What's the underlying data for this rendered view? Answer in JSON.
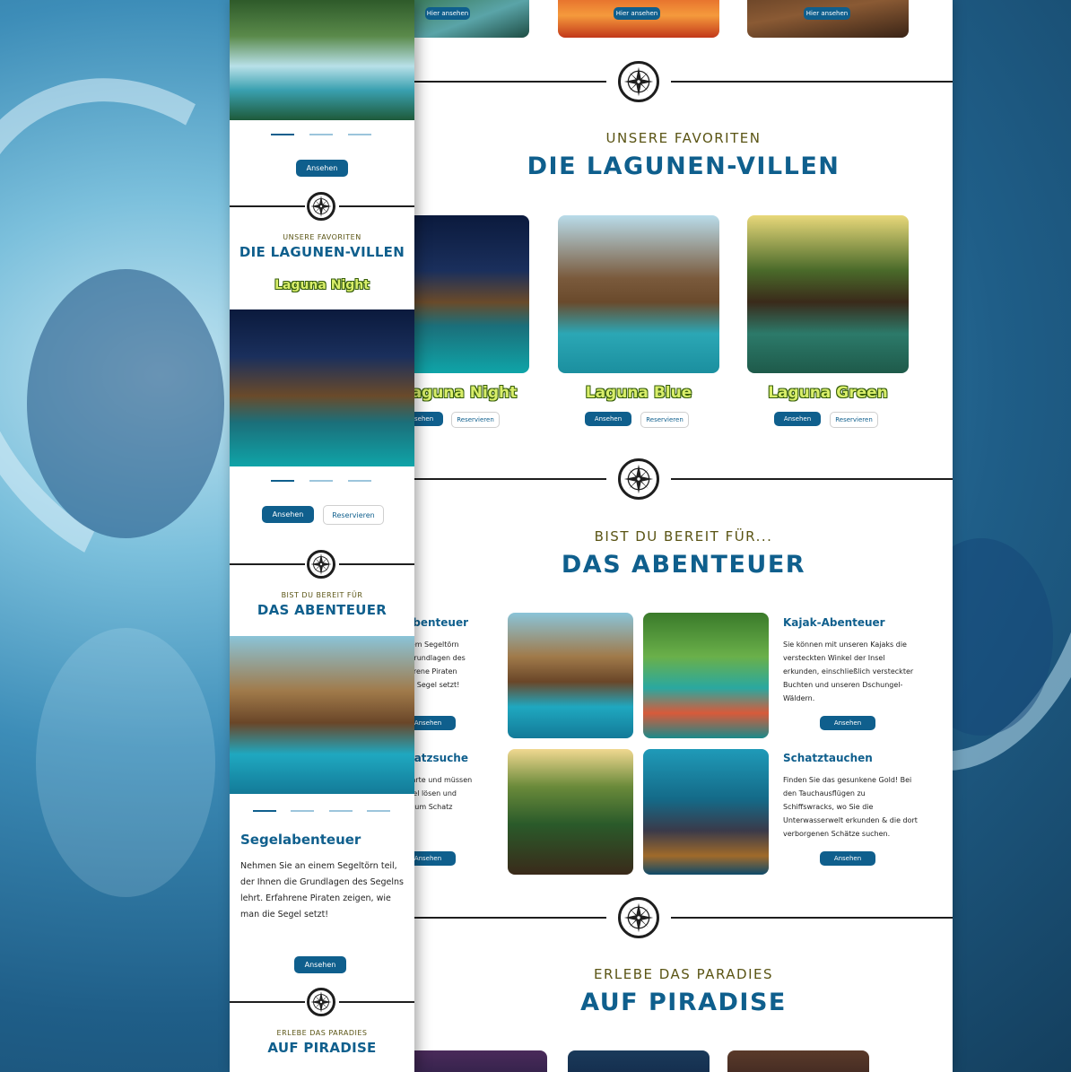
{
  "desktop": {
    "top_buttons": [
      "Hier ansehen",
      "Hier ansehen",
      "Hier ansehen"
    ],
    "villas": {
      "kicker": "UNSERE FAVORITEN",
      "heading": "DIE LAGUNEN-VILLEN",
      "items": [
        {
          "name": "Laguna Night",
          "view": "Ansehen",
          "reserve": "Reservieren"
        },
        {
          "name": "Laguna Blue",
          "view": "Ansehen",
          "reserve": "Reservieren"
        },
        {
          "name": "Laguna Green",
          "view": "Ansehen",
          "reserve": "Reservieren"
        }
      ]
    },
    "adventure": {
      "kicker": "BIST DU BEREIT FÜR...",
      "heading": "DAS ABENTEUER",
      "items": [
        {
          "title": "Segelabenteuer",
          "text": "Nehmen Sie an einem Segeltörn teil, der Ihnen die Grundlagen des Segelns lehrt. Erfahrene Piraten zeigen, wie man die Segel setzt!",
          "button": "Ansehen"
        },
        {
          "title": "Kajak-Abenteuer",
          "text": "Sie können mit unseren Kajaks die versteckten Winkel der Insel erkunden, einschließlich versteckter Buchten und unseren Dschungel-Wäldern.",
          "button": "Ansehen"
        },
        {
          "title": "Schatzsuche",
          "text": "Folgt einer Schatzkarte und müssen sie spannende Rätsel lösen und Schlüsseln, die sie zum Schatz führen.",
          "button": "Ansehen"
        },
        {
          "title": "Schatztauchen",
          "text": "Finden Sie das gesunkene Gold! Bei den Tauchausflügen zu Schiffswracks, wo Sie die Unterwasserwelt erkunden & die dort verborgenen Schätze suchen.",
          "button": "Ansehen"
        }
      ]
    },
    "paradise": {
      "kicker": "ERLEBE DAS PARADIES",
      "heading": "AUF PIRADISE"
    }
  },
  "mobile": {
    "top_button": "Ansehen",
    "villas": {
      "kicker": "UNSERE FAVORITEN",
      "heading": "DIE LAGUNEN-VILLEN",
      "villa_name": "Laguna Night",
      "view": "Ansehen",
      "reserve": "Reservieren"
    },
    "adventure": {
      "kicker": "BIST DU BEREIT FÜR",
      "heading": "DAS ABENTEUER",
      "title": "Segelabenteuer",
      "text": "Nehmen Sie an einem Segeltörn teil, der Ihnen die Grundlagen des Segelns lehrt. Erfahrene Piraten zeigen, wie man die Segel setzt!",
      "button": "Ansehen"
    },
    "paradise": {
      "kicker": "ERLEBE DAS PARADIES",
      "heading": "AUF PIRADISE"
    }
  },
  "colors": {
    "primary": "#0f5f8d",
    "kicker": "#5a5414",
    "villa_name": "#d9ee6a"
  },
  "icons": {
    "divider": "compass-icon"
  }
}
